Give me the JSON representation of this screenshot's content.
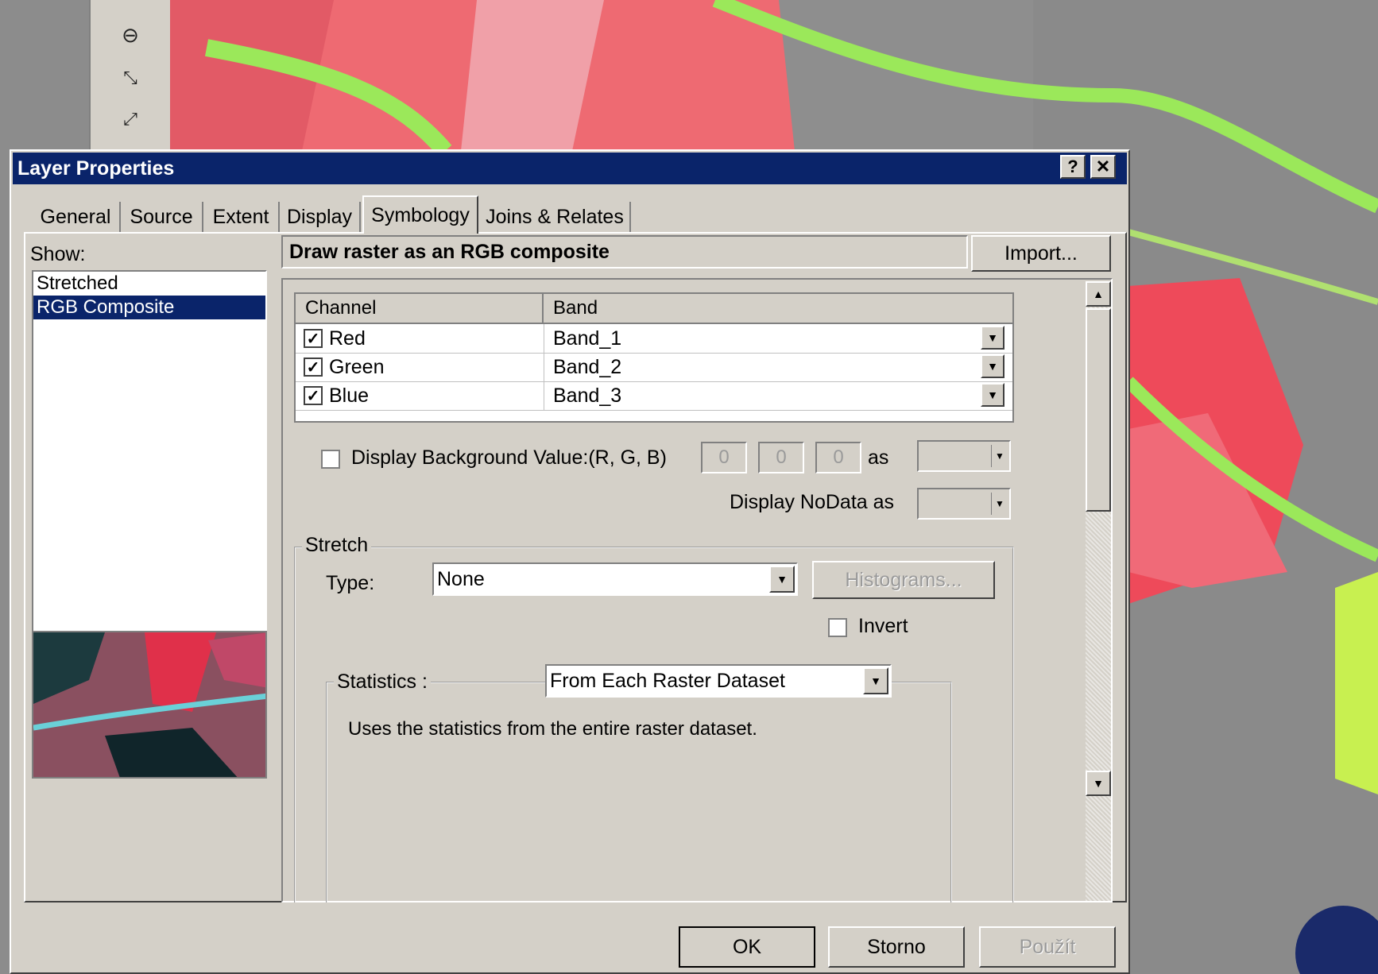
{
  "dialog": {
    "title": "Layer Properties",
    "help_label": "?",
    "close_label": "✕"
  },
  "tabs": [
    {
      "label": "General"
    },
    {
      "label": "Source"
    },
    {
      "label": "Extent"
    },
    {
      "label": "Display"
    },
    {
      "label": "Symbology",
      "active": true
    },
    {
      "label": "Joins & Relates"
    }
  ],
  "show": {
    "label": "Show:",
    "items": [
      "Stretched",
      "RGB Composite"
    ],
    "selected": "RGB Composite"
  },
  "main": {
    "heading": "Draw raster as an RGB composite",
    "import_label": "Import..."
  },
  "channel_table": {
    "headers": [
      "Channel",
      "Band"
    ],
    "rows": [
      {
        "channel": "Red",
        "band": "Band_1",
        "checked": true
      },
      {
        "channel": "Green",
        "band": "Band_2",
        "checked": true
      },
      {
        "channel": "Blue",
        "band": "Band_3",
        "checked": true
      }
    ]
  },
  "background": {
    "label": "Display Background Value:(R, G, B)",
    "checked": false,
    "r": "0",
    "g": "0",
    "b": "0",
    "as_label": "as"
  },
  "nodata": {
    "label": "Display NoData as"
  },
  "stretch": {
    "group_label": "Stretch",
    "type_label": "Type:",
    "type_value": "None",
    "histograms_label": "Histograms...",
    "invert_label": "Invert",
    "invert_checked": false
  },
  "statistics": {
    "label": "Statistics :",
    "value": "From Each Raster Dataset",
    "description": "Uses the statistics from the entire raster dataset."
  },
  "footer": {
    "ok_label": "OK",
    "cancel_label": "Storno",
    "apply_label": "Použít"
  },
  "colors": {
    "titlebar": "#0a246a",
    "dialog_bg": "#d4d0c8",
    "map_red": "#ee6a72",
    "map_gray": "#8c8c8c",
    "map_green": "#9be85a"
  },
  "icons": [
    "zoom-out-icon",
    "zoom-full-extent-icon",
    "zoom-fixed-out-icon",
    "dropdown-arrow-icon",
    "checkmark-icon",
    "scroll-up-icon",
    "scroll-down-icon"
  ]
}
